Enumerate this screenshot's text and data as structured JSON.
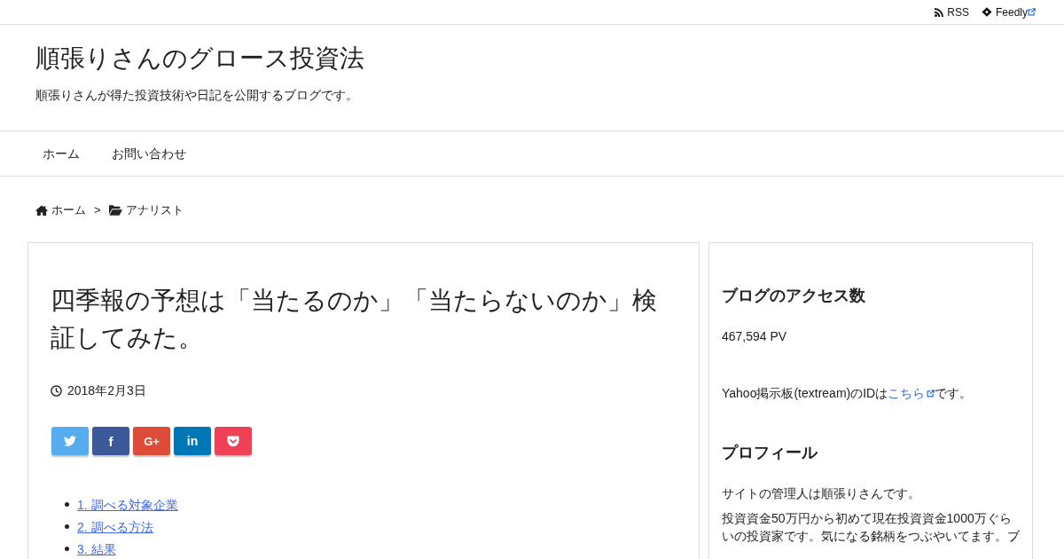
{
  "top_bar": {
    "links": [
      {
        "kind": "rss",
        "label": "RSS",
        "external": false
      },
      {
        "kind": "feedly",
        "label": "Feedly",
        "external": true
      }
    ]
  },
  "header": {
    "site_title": "順張りさんのグロース投資法",
    "tagline": "順張りさんが得た投資技術や日記を公開するブログです。"
  },
  "nav": {
    "items": [
      {
        "label": "ホーム"
      },
      {
        "label": "お問い合わせ"
      }
    ]
  },
  "breadcrumb": {
    "separator": ">",
    "items": [
      {
        "kind": "home",
        "label": "ホーム"
      },
      {
        "kind": "category",
        "label": "アナリスト"
      }
    ]
  },
  "article": {
    "title": "四季報の予想は「当たるのか」「当たらないのか」検証してみた。",
    "date": "2018年2月3日",
    "share_buttons": [
      {
        "kind": "twitter"
      },
      {
        "kind": "facebook",
        "label": "f"
      },
      {
        "kind": "google_plus",
        "label": "G+"
      },
      {
        "kind": "linkedin",
        "label": "in"
      },
      {
        "kind": "pocket"
      }
    ],
    "toc": [
      {
        "label": "1. 調べる対象企業"
      },
      {
        "label": "2. 調べる方法"
      },
      {
        "label": "3. 結果"
      }
    ]
  },
  "sidebar": {
    "widgets": [
      {
        "heading": "ブログのアクセス数",
        "paragraphs": [
          {
            "kind": "plain",
            "text": "467,594 PV"
          }
        ]
      },
      {
        "paragraphs": [
          {
            "kind": "link",
            "text_before": "Yahoo掲示板(textream)のIDは",
            "link": "こちら",
            "link_external": true,
            "text_after": "です。"
          }
        ]
      },
      {
        "heading": "プロフィール",
        "paragraphs": [
          {
            "kind": "plain",
            "text": "サイトの管理人は順張りさんです。"
          },
          {
            "kind": "plain",
            "text": "投資資金50万円から初めて現在投資資金1000万ぐらいの投資家です。気になる銘柄をつぶやいてます。ブ"
          }
        ]
      }
    ]
  }
}
